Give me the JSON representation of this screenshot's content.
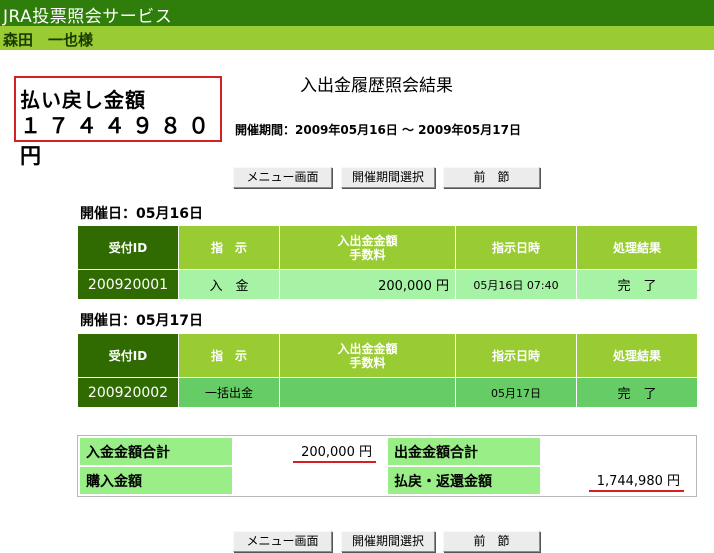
{
  "header": {
    "service_title": "JRA投票照会サービス",
    "user_name": "森田　一也様"
  },
  "payout_box": {
    "label": "払い戻し金額",
    "amount": "１７４４９８０円"
  },
  "page": {
    "title": "入出金履歴照会結果",
    "period": "開催期間：2009年05月16日 ～ 2009年05月17日"
  },
  "nav": {
    "menu": "メニュー画面",
    "period_select": "開催期間選択",
    "previous": "前　節"
  },
  "columns": {
    "receipt_id": "受付ID",
    "instruction": "指　示",
    "amount_line1": "入出金金額",
    "amount_line2": "手数料",
    "datetime": "指示日時",
    "result": "処理結果"
  },
  "days": [
    {
      "label": "開催日：05月16日",
      "rows": [
        {
          "id": "200920001",
          "instruction": "入　金",
          "amount": "200,000 円",
          "datetime": "05月16日 07:40",
          "result": "完　了"
        }
      ]
    },
    {
      "label": "開催日：05月17日",
      "rows": [
        {
          "id": "200920002",
          "instruction": "一括出金",
          "amount": "",
          "datetime": "05月17日",
          "result": "完　了"
        }
      ]
    }
  ],
  "summary": {
    "deposit_total_label": "入金金額合計",
    "deposit_total_value": "200,000 円",
    "withdraw_total_label": "出金金額合計",
    "withdraw_total_value": "",
    "purchase_label": "購入金額",
    "purchase_value": "",
    "refund_label": "払戻・返還金額",
    "refund_value": "1,744,980 円"
  },
  "colors": {
    "header_dark_green": "#2f7d0a",
    "header_light_green": "#99cc33",
    "table_header_green": "#99cc33",
    "id_cell_dark_green": "#2f6b00",
    "row_light_green": "#a6f3a6",
    "row_mid_green": "#66cc66",
    "summary_label_green": "#99ee88",
    "highlight_red": "#d42020"
  }
}
